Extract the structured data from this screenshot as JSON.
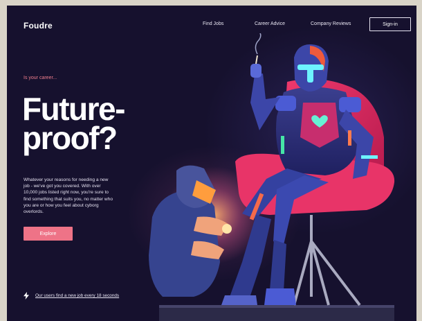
{
  "brand": {
    "logo": "Foudre"
  },
  "nav": {
    "items": [
      {
        "label": "Find Jobs"
      },
      {
        "label": "Career Advice"
      },
      {
        "label": "Company Reviews"
      }
    ],
    "signin_label": "Sign-in"
  },
  "hero": {
    "eyebrow": "Is your career...",
    "headline_line1": "Future-",
    "headline_line2": "proof?",
    "body": "Whatever your reasons for needing a new job - we've got you covered. With over 10,000 jobs listed right now, you're sure to find something that suits you, no matter who you are or how you feel about cyborg overlords.",
    "cta_label": "Explore"
  },
  "stat": {
    "icon": "lightning-icon",
    "text": "Our users find a new job every 18 seconds"
  },
  "colors": {
    "background": "#16112e",
    "accent": "#ee7387",
    "eyebrow": "#f17f8e",
    "text": "#ffffff"
  }
}
